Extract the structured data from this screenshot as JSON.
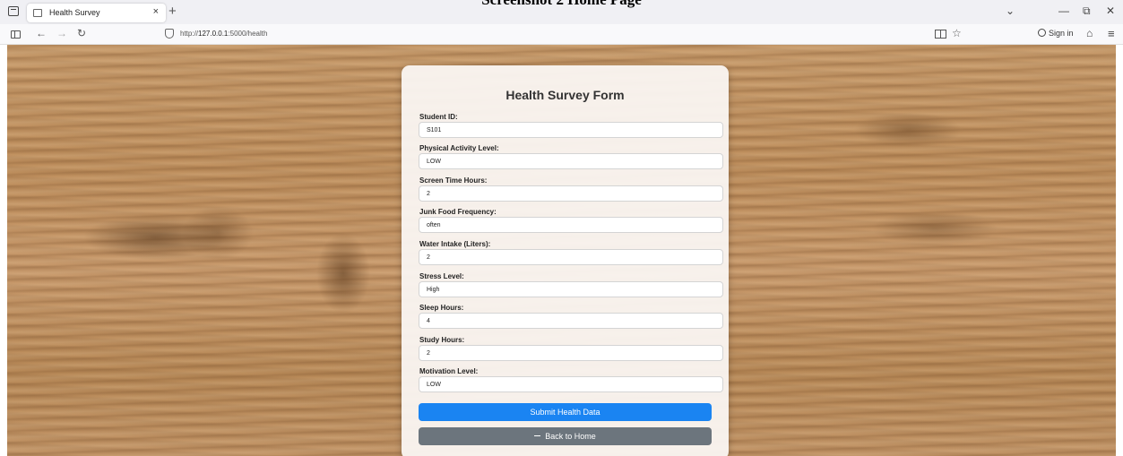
{
  "document_caption": "Screenshot 2 Home Page",
  "browser": {
    "tab_title": "Health Survey",
    "tab_close": "×",
    "new_tab": "+",
    "url_prefix": "http://",
    "url_host": "127.0.0.1",
    "url_path": ":5000/health",
    "signin_label": "Sign in",
    "window_controls": [
      "⌄",
      "—",
      "⧉",
      "✕"
    ]
  },
  "form": {
    "title": "Health Survey Form",
    "fields": [
      {
        "label": "Student ID:",
        "value": "S101"
      },
      {
        "label": "Physical Activity Level:",
        "value": "LOW"
      },
      {
        "label": "Screen Time Hours:",
        "value": "2"
      },
      {
        "label": "Junk Food Frequency:",
        "value": "often"
      },
      {
        "label": "Water Intake (Liters):",
        "value": "2"
      },
      {
        "label": "Stress Level:",
        "value": "High"
      },
      {
        "label": "Sleep Hours:",
        "value": "4"
      },
      {
        "label": "Study Hours:",
        "value": "2"
      },
      {
        "label": "Motivation Level:",
        "value": "LOW"
      }
    ],
    "submit_label": "Submit Health Data",
    "back_label": "Back to Home"
  },
  "colors": {
    "submit": "#1a84f2",
    "back": "#6c757d"
  }
}
